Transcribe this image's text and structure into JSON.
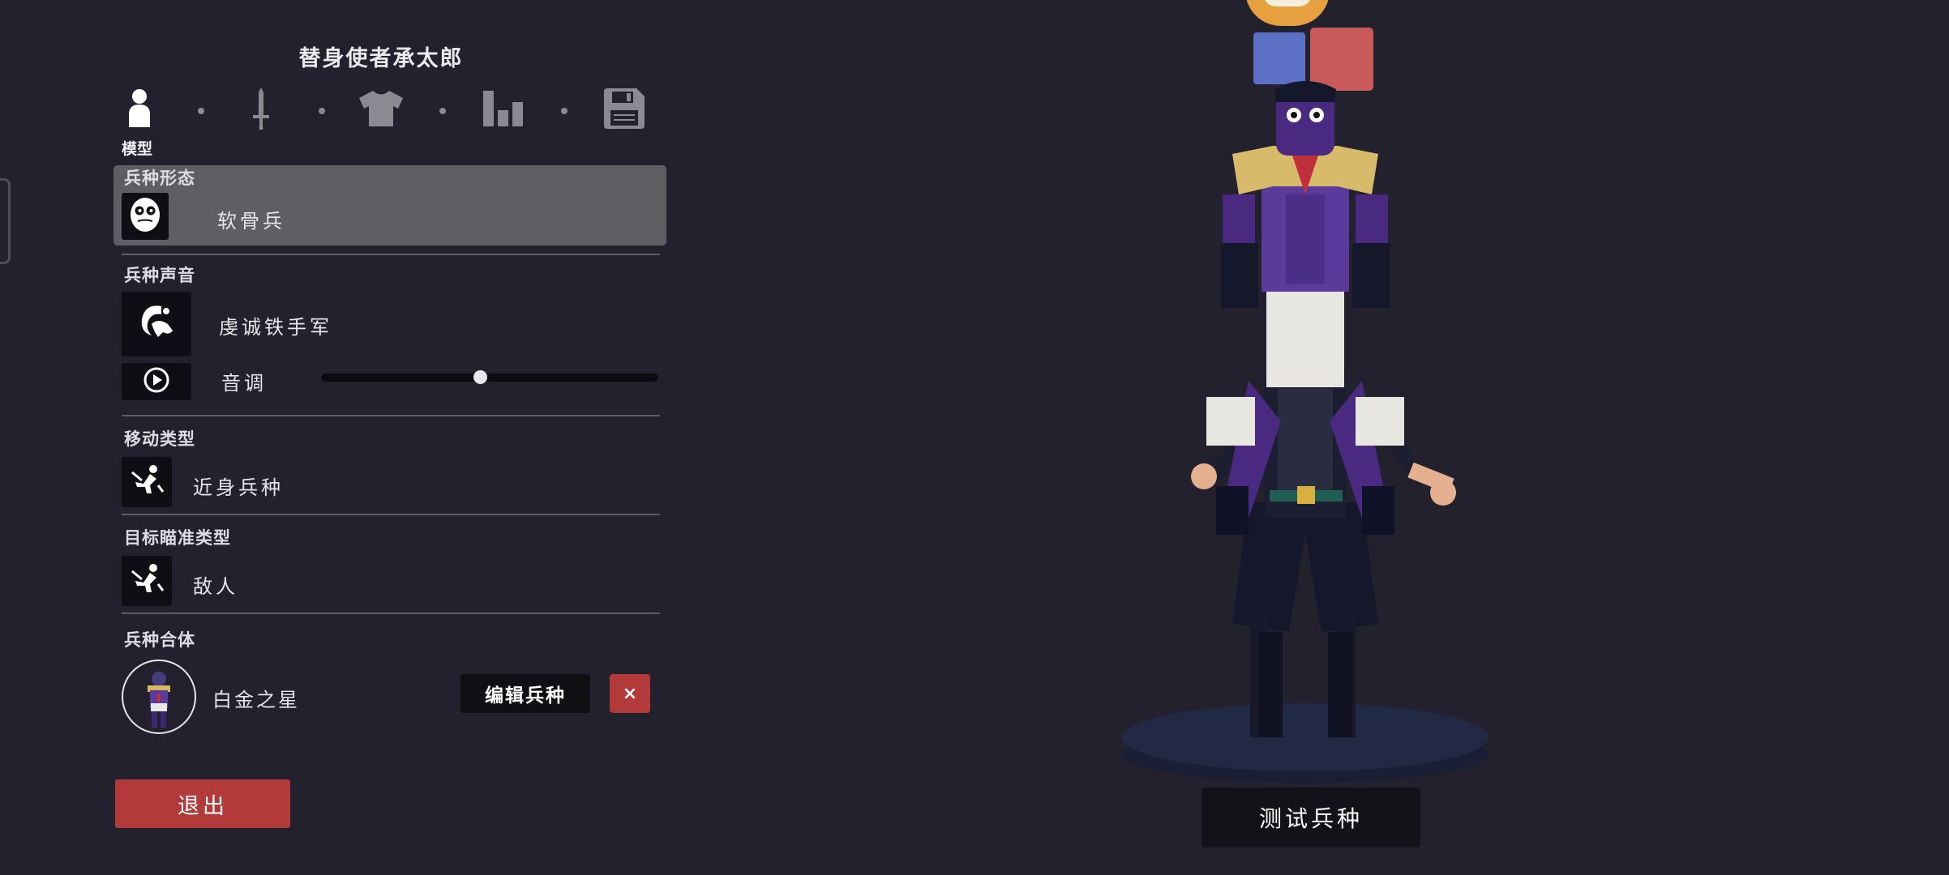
{
  "header": {
    "title": "替身使者承太郎"
  },
  "tabs": [
    {
      "icon": "person-icon",
      "label": "模型",
      "active": true
    },
    {
      "icon": "sword-icon",
      "active": false
    },
    {
      "icon": "shirt-icon",
      "active": false
    },
    {
      "icon": "stats-icon",
      "active": false
    },
    {
      "icon": "save-icon",
      "active": false
    }
  ],
  "sections": {
    "form": {
      "label": "兵种形态",
      "value": "软骨兵",
      "icon": "mask-face-icon"
    },
    "voice": {
      "label": "兵种声音",
      "value": "虔诚铁手军",
      "icon": "voice-icon",
      "pitch_label": "音调",
      "pitch_value": 0.47,
      "play_icon": "play-icon"
    },
    "movement": {
      "label": "移动类型",
      "value": "近身兵种",
      "icon": "melee-unit-icon"
    },
    "targeting": {
      "label": "目标瞄准类型",
      "value": "敌人",
      "icon": "target-unit-icon"
    },
    "combo": {
      "label": "兵种合体",
      "value": "白金之星",
      "edit_label": "编辑兵种",
      "remove_label": "×"
    }
  },
  "exit_label": "退出",
  "test_label": "测试兵种",
  "colors": {
    "background": "#23212e",
    "highlight": "#5e5e63",
    "danger": "#b33a3a",
    "team_blue": "#5b6fc4",
    "team_red": "#c95a5a"
  }
}
